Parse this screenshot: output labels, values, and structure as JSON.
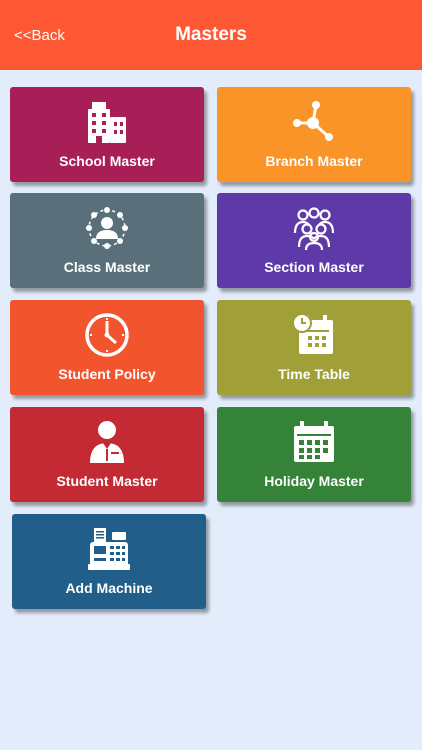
{
  "header": {
    "back_label": "<<Back",
    "title": "Masters",
    "color": "#fd5833"
  },
  "tiles": [
    {
      "label": "School Master",
      "icon": "school-buildings-icon",
      "color": "#a81f57"
    },
    {
      "label": "Branch Master",
      "icon": "branch-network-icon",
      "color": "#fa9328"
    },
    {
      "label": "Class Master",
      "icon": "class-network-icon",
      "color": "#59707b"
    },
    {
      "label": "Section Master",
      "icon": "people-group-icon",
      "color": "#5e3aa9"
    },
    {
      "label": "Student Policy",
      "icon": "clock-icon",
      "color": "#f2542d"
    },
    {
      "label": "Time Table",
      "icon": "calendar-clock-icon",
      "color": "#a19f37"
    },
    {
      "label": "Student Master",
      "icon": "student-person-icon",
      "color": "#c42a34"
    },
    {
      "label": "Holiday Master",
      "icon": "calendar-icon",
      "color": "#348338"
    },
    {
      "label": "Add Machine",
      "icon": "cash-machine-icon",
      "color": "#215e8a"
    }
  ]
}
